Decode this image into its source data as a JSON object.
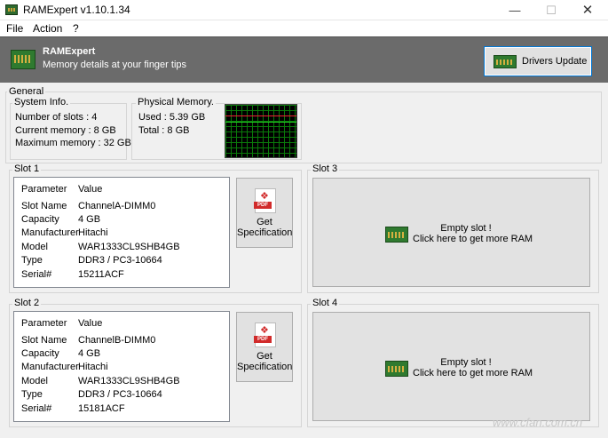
{
  "window": {
    "title": "RAMExpert v1.10.1.34"
  },
  "menu": [
    "File",
    "Action",
    "?"
  ],
  "banner": {
    "name": "RAMExpert",
    "tagline": "Memory details at your finger tips",
    "drivers_button": "Drivers Update"
  },
  "general": {
    "label": "General",
    "system_info": {
      "label": "System Info.",
      "rows": [
        "Number of slots : 4",
        "Current memory : 8 GB",
        "Maximum memory : 32 GB"
      ]
    },
    "physical_memory": {
      "label": "Physical Memory.",
      "rows": [
        "Used : 5.39 GB",
        "Total : 8 GB"
      ]
    }
  },
  "slots": [
    {
      "label": "Slot 1",
      "header": [
        "Parameter",
        "Value"
      ],
      "rows": [
        [
          "Slot Name",
          "ChannelA-DIMM0"
        ],
        [
          "Capacity",
          "4 GB"
        ],
        [
          "Manufacturer",
          "Hitachi"
        ],
        [
          "Model",
          "WAR1333CL9SHB4GB"
        ],
        [
          "Type",
          "DDR3 / PC3-10664"
        ],
        [
          "Serial#",
          "15211ACF"
        ]
      ],
      "spec_button": [
        "Get",
        "Specification"
      ]
    },
    {
      "label": "Slot 2",
      "header": [
        "Parameter",
        "Value"
      ],
      "rows": [
        [
          "Slot Name",
          "ChannelB-DIMM0"
        ],
        [
          "Capacity",
          "4 GB"
        ],
        [
          "Manufacturer",
          "Hitachi"
        ],
        [
          "Model",
          "WAR1333CL9SHB4GB"
        ],
        [
          "Type",
          "DDR3 / PC3-10664"
        ],
        [
          "Serial#",
          "15181ACF"
        ]
      ],
      "spec_button": [
        "Get",
        "Specification"
      ]
    },
    {
      "label": "Slot 3",
      "empty": [
        "Empty slot !",
        "Click here to get more RAM"
      ]
    },
    {
      "label": "Slot 4",
      "empty": [
        "Empty slot !",
        "Click here to get more RAM"
      ]
    }
  ],
  "pdf_label": "PDF",
  "watermark": "www.cfan.com.cn"
}
